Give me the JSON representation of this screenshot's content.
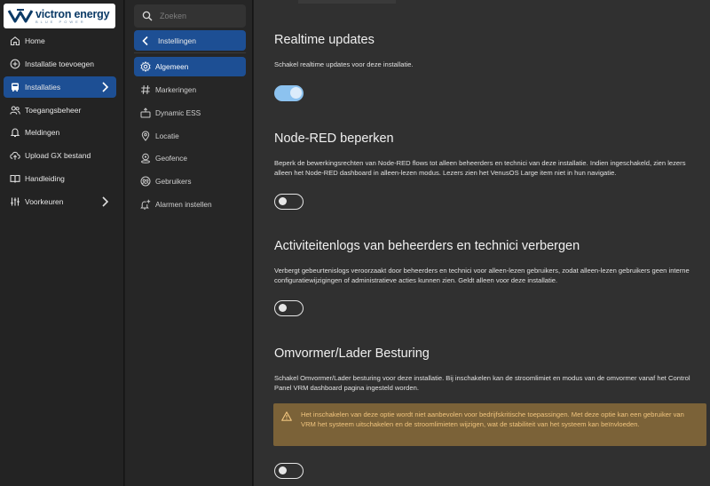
{
  "brand": {
    "name": "victron energy",
    "tagline": "BLUE POWER"
  },
  "nav": {
    "items": [
      {
        "label": "Home",
        "icon": "home-icon"
      },
      {
        "label": "Installatie toevoegen",
        "icon": "plus-circle-icon"
      },
      {
        "label": "Installaties",
        "icon": "installation-icon",
        "active": true
      },
      {
        "label": "Toegangsbeheer",
        "icon": "users-icon"
      },
      {
        "label": "Meldingen",
        "icon": "bell-icon"
      },
      {
        "label": "Upload GX bestand",
        "icon": "upload-cloud-icon"
      },
      {
        "label": "Handleiding",
        "icon": "book-icon"
      },
      {
        "label": "Voorkeuren",
        "icon": "sliders-icon"
      }
    ]
  },
  "subnav": {
    "search_placeholder": "Zoeken",
    "back_label": "Instellingen",
    "items": [
      {
        "label": "Algemeen",
        "icon": "gear-icon",
        "active": true
      },
      {
        "label": "Markeringen",
        "icon": "hash-icon"
      },
      {
        "label": "Dynamic ESS",
        "icon": "ess-icon"
      },
      {
        "label": "Locatie",
        "icon": "location-pin-icon"
      },
      {
        "label": "Geofence",
        "icon": "geofence-icon"
      },
      {
        "label": "Gebruikers",
        "icon": "users-icon"
      },
      {
        "label": "Alarmen instellen",
        "icon": "bell-plus-icon"
      }
    ]
  },
  "sections": [
    {
      "title": "Realtime updates",
      "description": "Schakel realtime updates voor deze installatie.",
      "enabled": true
    },
    {
      "title": "Node-RED beperken",
      "description": "Beperk de bewerkingsrechten van Node-RED flows tot alleen beheerders en technici van deze installatie. Indien ingeschakeld, zien lezers alleen het Node-RED dashboard in alleen-lezen modus. Lezers zien het VenusOS Large item niet in hun navigatie.",
      "enabled": false
    },
    {
      "title": "Activiteitenlogs van beheerders en technici verbergen",
      "description": "Verbergt gebeurtenislogs veroorzaakt door beheerders en technici voor alleen-lezen gebruikers, zodat alleen-lezen gebruikers geen interne configuratiewijzigingen of administratieve acties kunnen zien. Geldt alleen voor deze installatie.",
      "enabled": false
    },
    {
      "title": "Omvormer/Lader Besturing",
      "description": "Schakel Omvormer/Lader besturing voor deze installatie. Bij inschakelen kan de stroomlimiet en modus van de omvormer vanaf het Control Panel VRM dashboard pagina ingesteld worden.",
      "warning": "Het inschakelen van deze optie wordt niet aanbevolen voor bedrijfskritische toepassingen. Met deze optie kan een gebruiker van VRM het systeem uitschakelen en de stroomlimieten wijzigen, wat de stabiliteit van het systeem kan beïnvloeden.",
      "enabled": false
    }
  ],
  "colors": {
    "accent": "#1d4f94",
    "toggle_on": "#8cc2ef",
    "warning_bg": "#7b6238",
    "warning_text": "#f0c47e"
  }
}
